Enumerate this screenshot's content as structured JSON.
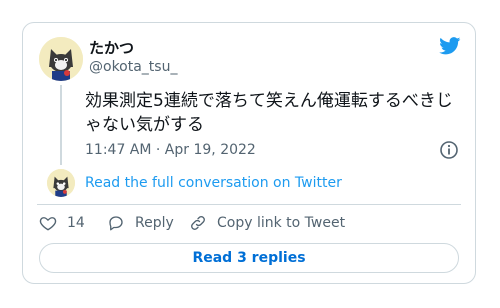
{
  "tweet": {
    "author_name": "たかつ",
    "author_handle": "@okota_tsu_",
    "text": "効果測定5連続で落ちて笑えん俺運転するべきじゃない気がする",
    "timestamp": "11:47 AM · Apr 19, 2022"
  },
  "conversation_link": "Read the full conversation on Twitter",
  "actions": {
    "like_count": "14",
    "reply_label": "Reply",
    "copy_label": "Copy link to Tweet"
  },
  "read_replies_label": "Read 3 replies",
  "colors": {
    "brand": "#1d9bf0",
    "link": "#1d9bf0",
    "muted": "#536471",
    "border": "#cfd9de"
  },
  "icons": {
    "brand": "bird-logo-icon",
    "info": "info-icon",
    "like": "heart-icon",
    "reply": "reply-bubble-icon",
    "copy": "link-chain-icon"
  }
}
